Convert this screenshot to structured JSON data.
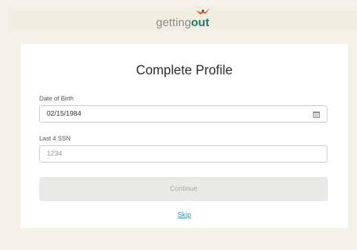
{
  "header": {
    "logo_light": "getting",
    "logo_bold": "out",
    "bird_color": "#e0552b"
  },
  "card": {
    "title": "Complete Profile"
  },
  "dob": {
    "label": "Date of Birth",
    "value": "02/15/1984",
    "icon": "calendar-icon"
  },
  "ssn": {
    "label": "Last 4 SSN",
    "placeholder": "1234",
    "value": ""
  },
  "actions": {
    "continue_label": "Continue",
    "skip_label": "Skip"
  },
  "colors": {
    "background": "#f4f1e9",
    "brand_teal": "#1f7a6e",
    "link": "#2f8fa8",
    "disabled_button": "#ebe9e4"
  }
}
